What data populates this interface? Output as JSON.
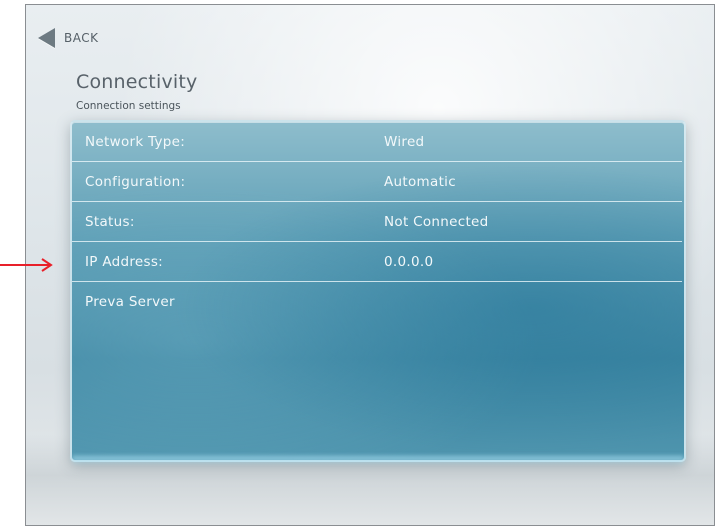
{
  "header": {
    "back_label": "BACK",
    "title": "Connectivity",
    "subtitle": "Connection settings"
  },
  "settings": [
    {
      "label": "Network Type:",
      "value": "Wired"
    },
    {
      "label": "Configuration:",
      "value": "Automatic"
    },
    {
      "label": "Status:",
      "value": "Not Connected"
    },
    {
      "label": "IP Address:",
      "value": "0.0.0.0"
    }
  ],
  "server_item": {
    "label": "Preva Server"
  },
  "colors": {
    "panel_blue": "#3d86a2",
    "annotation_arrow": "#e8202a"
  },
  "icons": {
    "back": "back-arrow-icon",
    "annotation": "red-pointer-arrow-icon"
  }
}
